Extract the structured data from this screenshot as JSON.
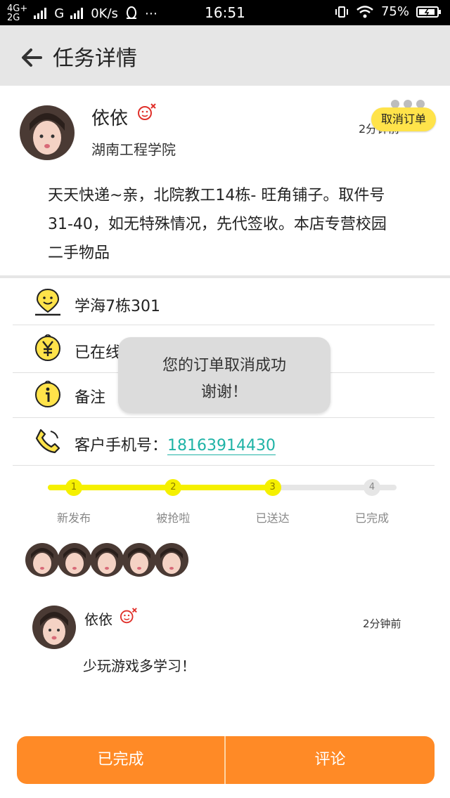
{
  "status_bar": {
    "network_top": "4G+",
    "network_bottom": "2G",
    "carrier_g": "G",
    "speed": "0K/s",
    "more": "⋯",
    "time": "16:51",
    "battery": "75%"
  },
  "header": {
    "title": "任务详情"
  },
  "task": {
    "user_name": "依依",
    "school": "湖南工程学院",
    "time_ago": "2分钟前",
    "cancel_label": "取消订单",
    "description_lines": [
      "天天快递~亲，北院教工14栋- 旺角铺子。取件号",
      "31-40，如无特殊情况，先代签收。本店专营校园",
      "二手物品"
    ]
  },
  "details": {
    "address": "学海7栋301",
    "payment": "已在线",
    "note": "备注",
    "phone_label": "客户手机号：",
    "phone_number": "18163914430"
  },
  "progress": {
    "current_step": 3,
    "steps": [
      {
        "num": "1",
        "label": "新发布"
      },
      {
        "num": "2",
        "label": "被抢啦"
      },
      {
        "num": "3",
        "label": "已送达"
      },
      {
        "num": "4",
        "label": "已完成"
      }
    ]
  },
  "comment": {
    "user_name": "依依",
    "time_ago": "2分钟前",
    "text": "少玩游戏多学习！"
  },
  "toast": {
    "line1": "您的订单取消成功",
    "line2": "谢谢！"
  },
  "actions": {
    "complete_label": "已完成",
    "comment_label": "评论"
  },
  "colors": {
    "accent_yellow": "#ffe34a",
    "progress_yellow": "#f5f000",
    "teal_link": "#1fb3a6",
    "button_orange": "#ff8a26",
    "header_gray": "#e6e6e6"
  }
}
